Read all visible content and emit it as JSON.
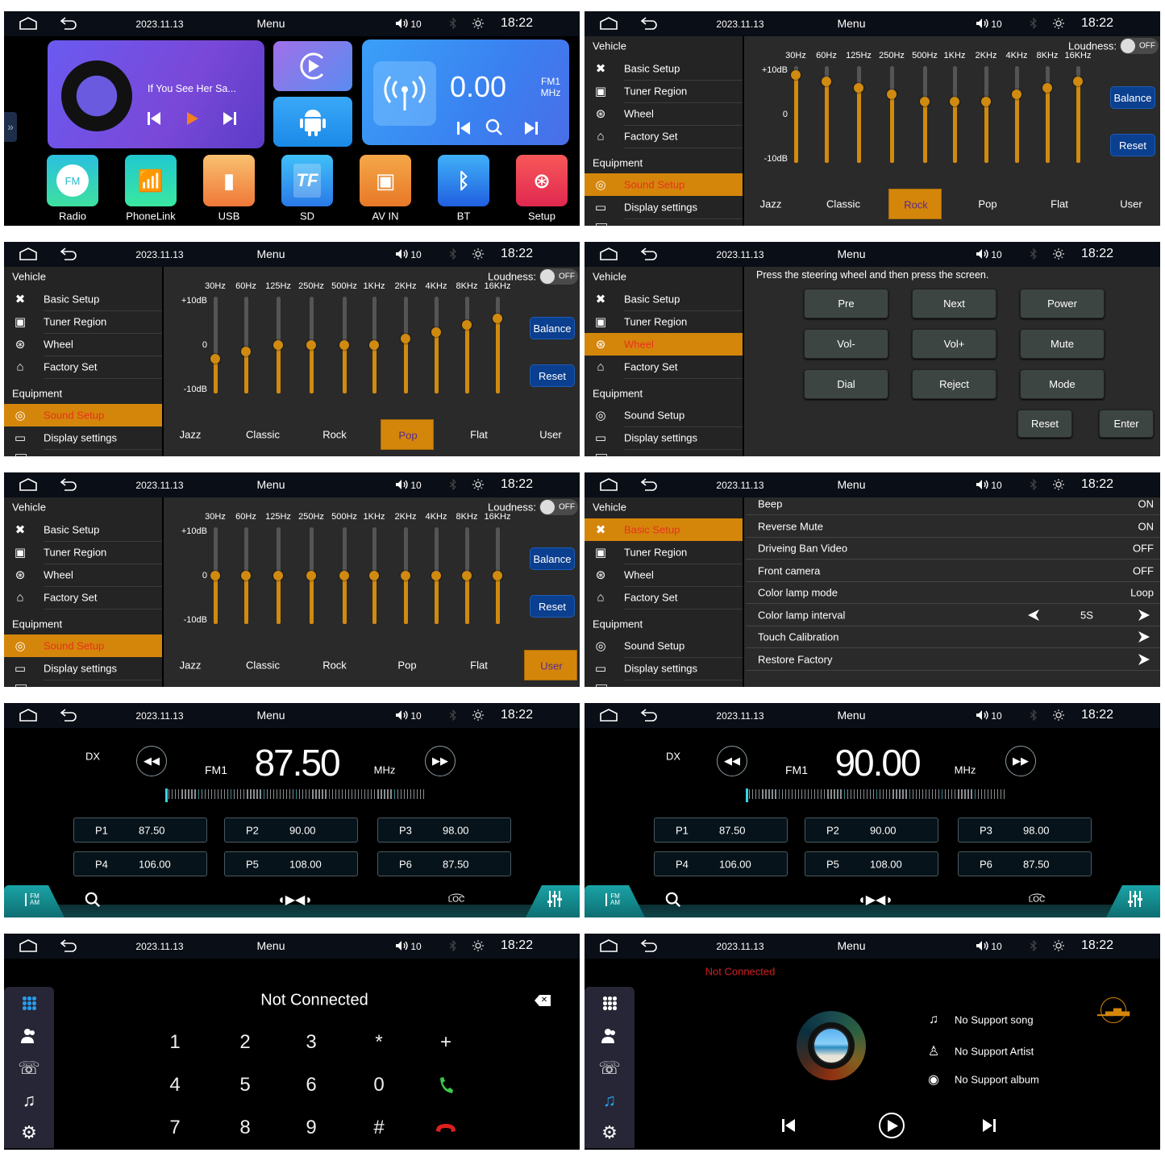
{
  "status": {
    "date": "2023.11.13",
    "title": "Menu",
    "volume": "10",
    "time": "18:22"
  },
  "colors": {
    "accent": "#d4860b",
    "active_text": "#e8321e",
    "button_blue": "#0b3f8f",
    "teal": "#1a9fa0",
    "call_green": "#3cc84a",
    "hangup_red": "#e02020"
  },
  "home": {
    "now_playing": "If You See Her Sa...",
    "radio": {
      "frequency": "0.00",
      "band": "FM1",
      "unit": "MHz"
    },
    "apps": [
      {
        "label": "Radio",
        "icon": "fm-radio-icon",
        "icon_text": "FM"
      },
      {
        "label": "PhoneLink",
        "icon": "phone-link-icon"
      },
      {
        "label": "USB",
        "icon": "usb-icon"
      },
      {
        "label": "SD",
        "icon": "sd-card-icon",
        "icon_text": "TF"
      },
      {
        "label": "AV IN",
        "icon": "film-icon"
      },
      {
        "label": "BT",
        "icon": "bluetooth-icon"
      },
      {
        "label": "Setup",
        "icon": "steering-wheel-icon"
      }
    ]
  },
  "settings_menu": {
    "vehicle": "Vehicle",
    "equipment": "Equipment",
    "items": [
      {
        "label": "Basic Setup",
        "icon": "tools-icon"
      },
      {
        "label": "Tuner Region",
        "icon": "radio-icon"
      },
      {
        "label": "Wheel",
        "icon": "steering-wheel-icon"
      },
      {
        "label": "Factory Set",
        "icon": "factory-icon"
      },
      {
        "label": "Sound Setup",
        "icon": "speaker-icon"
      },
      {
        "label": "Display settings",
        "icon": "monitor-icon"
      }
    ]
  },
  "eq": {
    "bands": [
      "30Hz",
      "60Hz",
      "125Hz",
      "250Hz",
      "500Hz",
      "1KHz",
      "2KHz",
      "4KHz",
      "8KHz",
      "16KHz"
    ],
    "scale": [
      "+10dB",
      "0",
      "-10dB"
    ],
    "range_db": [
      -10,
      10
    ],
    "loudness_label": "Loudness:",
    "loudness_state": "OFF",
    "balance_label": "Balance",
    "reset_label": "Reset",
    "presets": [
      "Jazz",
      "Classic",
      "Rock",
      "Pop",
      "Flat",
      "User"
    ]
  },
  "eq_rock": {
    "active_menu": "Sound Setup",
    "selected_preset": "Rock",
    "gains_db": [
      9,
      7.5,
      6,
      4.5,
      3,
      3,
      3,
      4.5,
      6,
      7.5
    ]
  },
  "eq_pop": {
    "active_menu": "Sound Setup",
    "selected_preset": "Pop",
    "gains_db": [
      -3,
      -1.5,
      0,
      0,
      0,
      0,
      1.5,
      3,
      4.5,
      6
    ]
  },
  "eq_user": {
    "active_menu": "Sound Setup",
    "selected_preset": "User",
    "gains_db": [
      0,
      0,
      0,
      0,
      0,
      0,
      0,
      0,
      0,
      0
    ]
  },
  "wheel": {
    "active_menu": "Wheel",
    "instruction": "Press the steering wheel and then press the screen.",
    "keys": [
      "Pre",
      "Next",
      "Power",
      "Vol-",
      "Vol+",
      "Mute",
      "Dial",
      "Reject",
      "Mode"
    ],
    "reset_label": "Reset",
    "enter_label": "Enter"
  },
  "basic_setup": {
    "active_menu": "Basic Setup",
    "rows": [
      {
        "label": "Beep",
        "value": "ON"
      },
      {
        "label": "Reverse Mute",
        "value": "ON"
      },
      {
        "label": "Driveing Ban Video",
        "value": "OFF"
      },
      {
        "label": "Front camera",
        "value": "OFF"
      },
      {
        "label": "Color lamp mode",
        "value": "Loop"
      },
      {
        "label": "Color lamp interval",
        "value": "5S",
        "stepper": true
      },
      {
        "label": "Touch Calibration",
        "arrow": true
      },
      {
        "label": "Restore Factory",
        "arrow": true
      }
    ]
  },
  "radio": {
    "dx": "DX",
    "band": "FM1",
    "unit": "MHz",
    "loc_icon_text": "LOC",
    "fmam_icon_text": "FM AM",
    "screens": [
      {
        "frequency": "87.50"
      },
      {
        "frequency": "90.00"
      }
    ],
    "presets": [
      {
        "label": "P1",
        "freq": "87.50"
      },
      {
        "label": "P2",
        "freq": "90.00"
      },
      {
        "label": "P3",
        "freq": "98.00"
      },
      {
        "label": "P4",
        "freq": "106.00"
      },
      {
        "label": "P5",
        "freq": "108.00"
      },
      {
        "label": "P6",
        "freq": "87.50"
      }
    ]
  },
  "phone": {
    "status": "Not Connected",
    "keys": [
      "1",
      "2",
      "3",
      "*",
      "+",
      "4",
      "5",
      "6",
      "0",
      "call",
      "7",
      "8",
      "9",
      "#",
      "hangup"
    ],
    "active_tab": "dialpad"
  },
  "music": {
    "status": "Not Connected",
    "song": "No Support song",
    "artist": "No Support Artist",
    "album": "No Support album",
    "active_tab": "music"
  }
}
